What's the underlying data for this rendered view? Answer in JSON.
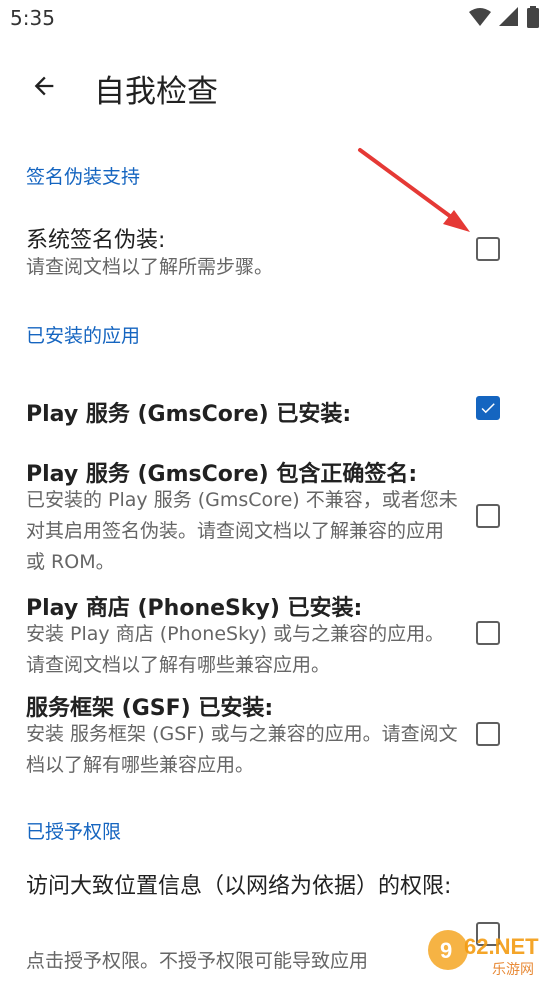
{
  "status_bar": {
    "time": "5:35"
  },
  "app_bar": {
    "title": "自我检查"
  },
  "sections": {
    "signature": {
      "header": "签名伪装支持",
      "item": {
        "title": "系统签名伪装:",
        "summary": "请查阅文档以了解所需步骤。",
        "checked": false
      }
    },
    "installed": {
      "header": "已安装的应用",
      "items": [
        {
          "title": "Play 服务 (GmsCore) 已安装:",
          "summary": "",
          "checked": true
        },
        {
          "title": "Play 服务 (GmsCore) 包含正确签名:",
          "summary": "已安装的 Play 服务 (GmsCore) 不兼容，或者您未对其启用签名伪装。请查阅文档以了解兼容的应用或 ROM。",
          "checked": false
        },
        {
          "title": "Play 商店 (PhoneSky) 已安装:",
          "summary": "安装 Play 商店 (PhoneSky) 或与之兼容的应用。请查阅文档以了解有哪些兼容应用。",
          "checked": false
        },
        {
          "title": "服务框架 (GSF) 已安装:",
          "summary": "安装 服务框架 (GSF) 或与之兼容的应用。请查阅文档以了解有哪些兼容应用。",
          "checked": false
        }
      ]
    },
    "permissions": {
      "header": "已授予权限",
      "item": {
        "title": "访问大致位置信息（以网络为依据）的权限:",
        "summary": "点击授予权限。不授予权限可能导致应用",
        "checked": false
      }
    }
  },
  "watermark": {
    "text": "962.NET",
    "subtext": "乐游网"
  },
  "colors": {
    "accent": "#1565c0",
    "annotation_arrow": "#e53935"
  },
  "icons": {
    "back": "arrow-left-icon",
    "wifi": "wifi-icon",
    "signal": "signal-icon",
    "battery": "battery-icon"
  }
}
